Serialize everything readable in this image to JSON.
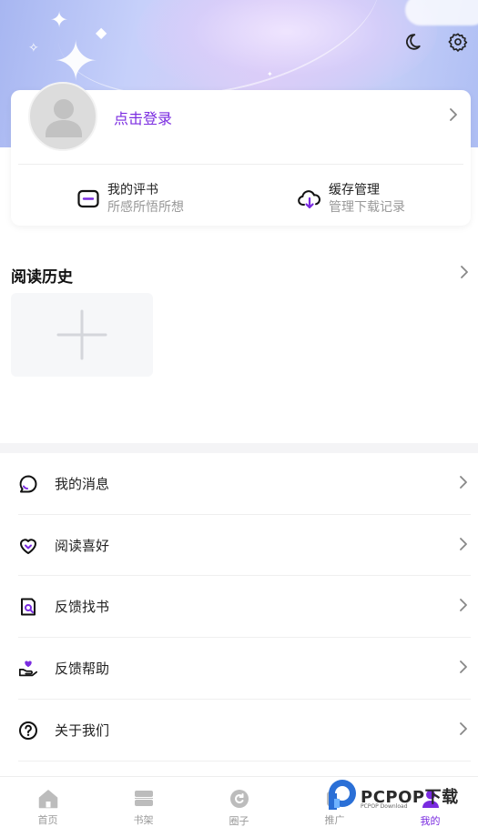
{
  "header": {
    "top_icons": [
      "moon-icon",
      "gear-icon"
    ]
  },
  "user": {
    "login_label": "点击登录"
  },
  "shortcuts": [
    {
      "title": "我的评书",
      "subtitle": "所感所悟所想",
      "icon": "comment-book-icon"
    },
    {
      "title": "缓存管理",
      "subtitle": "管理下载记录",
      "icon": "cloud-download-icon"
    }
  ],
  "history": {
    "title": "阅读历史"
  },
  "menu": [
    {
      "label": "我的消息",
      "icon": "message-icon"
    },
    {
      "label": "阅读喜好",
      "icon": "heart-icon"
    },
    {
      "label": "反馈找书",
      "icon": "book-search-icon"
    },
    {
      "label": "反馈帮助",
      "icon": "hand-heart-icon"
    },
    {
      "label": "关于我们",
      "icon": "question-icon"
    }
  ],
  "nav": [
    {
      "label": "首页",
      "icon": "home-icon",
      "active": false
    },
    {
      "label": "书架",
      "icon": "bookshelf-icon",
      "active": false
    },
    {
      "label": "圈子",
      "icon": "circle-icon",
      "active": false
    },
    {
      "label": "推广",
      "icon": "promote-icon",
      "active": false
    },
    {
      "label": "我的",
      "icon": "profile-icon",
      "active": true
    }
  ],
  "watermark": {
    "brand": "PCPOP下载",
    "sub": "PCPOP Download"
  },
  "colors": {
    "accent": "#7a2be0",
    "text": "#222222",
    "muted": "#999999"
  }
}
